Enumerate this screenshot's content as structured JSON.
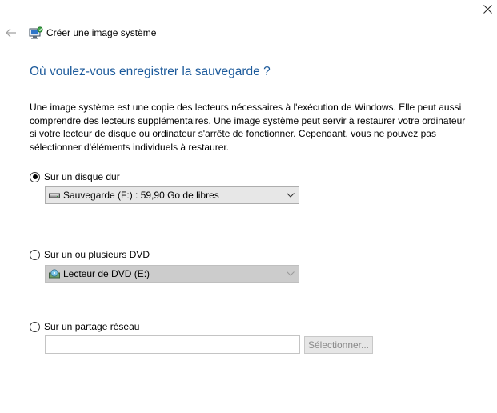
{
  "window": {
    "title": "Créer une image système",
    "close_icon": "close-icon",
    "back_icon": "back-arrow-icon",
    "app_icon": "system-image-backup-icon"
  },
  "main": {
    "heading": "Où voulez-vous enregistrer la sauvegarde ?",
    "description": "Une image système est une copie des lecteurs nécessaires à l'exécution de Windows. Elle peut aussi comprendre des lecteurs supplémentaires. Une image système peut servir à restaurer votre ordinateur si votre lecteur de disque ou ordinateur s'arrête de fonctionner. Cependant, vous ne pouvez pas sélectionner d'éléments individuels à restaurer."
  },
  "options": {
    "hard_disk": {
      "label": "Sur un disque dur",
      "selected": true,
      "dropdown_value": "Sauvegarde (F:) : 59,90 Go de libres",
      "dropdown_icon": "hard-drive-icon",
      "enabled": true
    },
    "dvd": {
      "label": "Sur un ou plusieurs DVD",
      "selected": false,
      "dropdown_value": "Lecteur de DVD (E:)",
      "dropdown_icon": "dvd-drive-icon",
      "enabled": false
    },
    "network": {
      "label": "Sur un partage réseau",
      "selected": false,
      "input_value": "",
      "button_label": "Sélectionner...",
      "button_enabled": false
    }
  },
  "colors": {
    "heading": "#1c5a9b",
    "disabled_dropdown": "#cccccc",
    "enabled_dropdown": "#e7e7e7",
    "disabled_text": "#8a8a8a"
  }
}
